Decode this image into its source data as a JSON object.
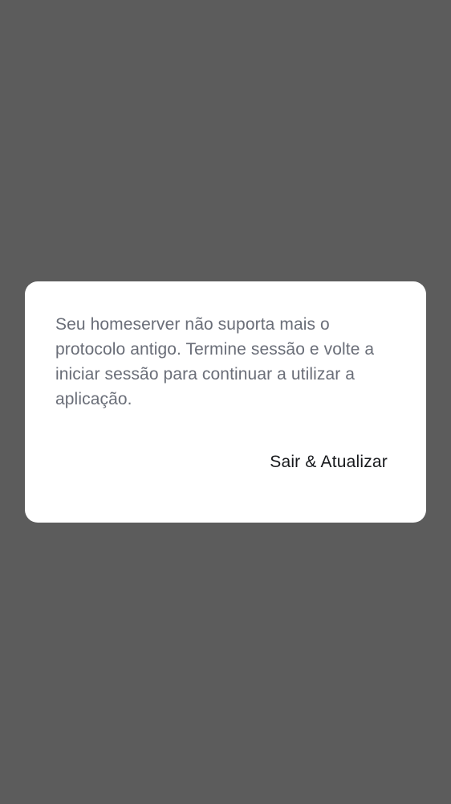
{
  "dialog": {
    "message": "Seu homeserver não suporta mais o protocolo antigo. Termine sessão e volte a iniciar sessão para continuar a utilizar a aplicação.",
    "action_label": "Sair & Atualizar"
  },
  "colors": {
    "scrim": "#5c5c5c",
    "dialog_background": "#ffffff",
    "message_text": "#6a6e78",
    "action_text": "#17191c"
  }
}
